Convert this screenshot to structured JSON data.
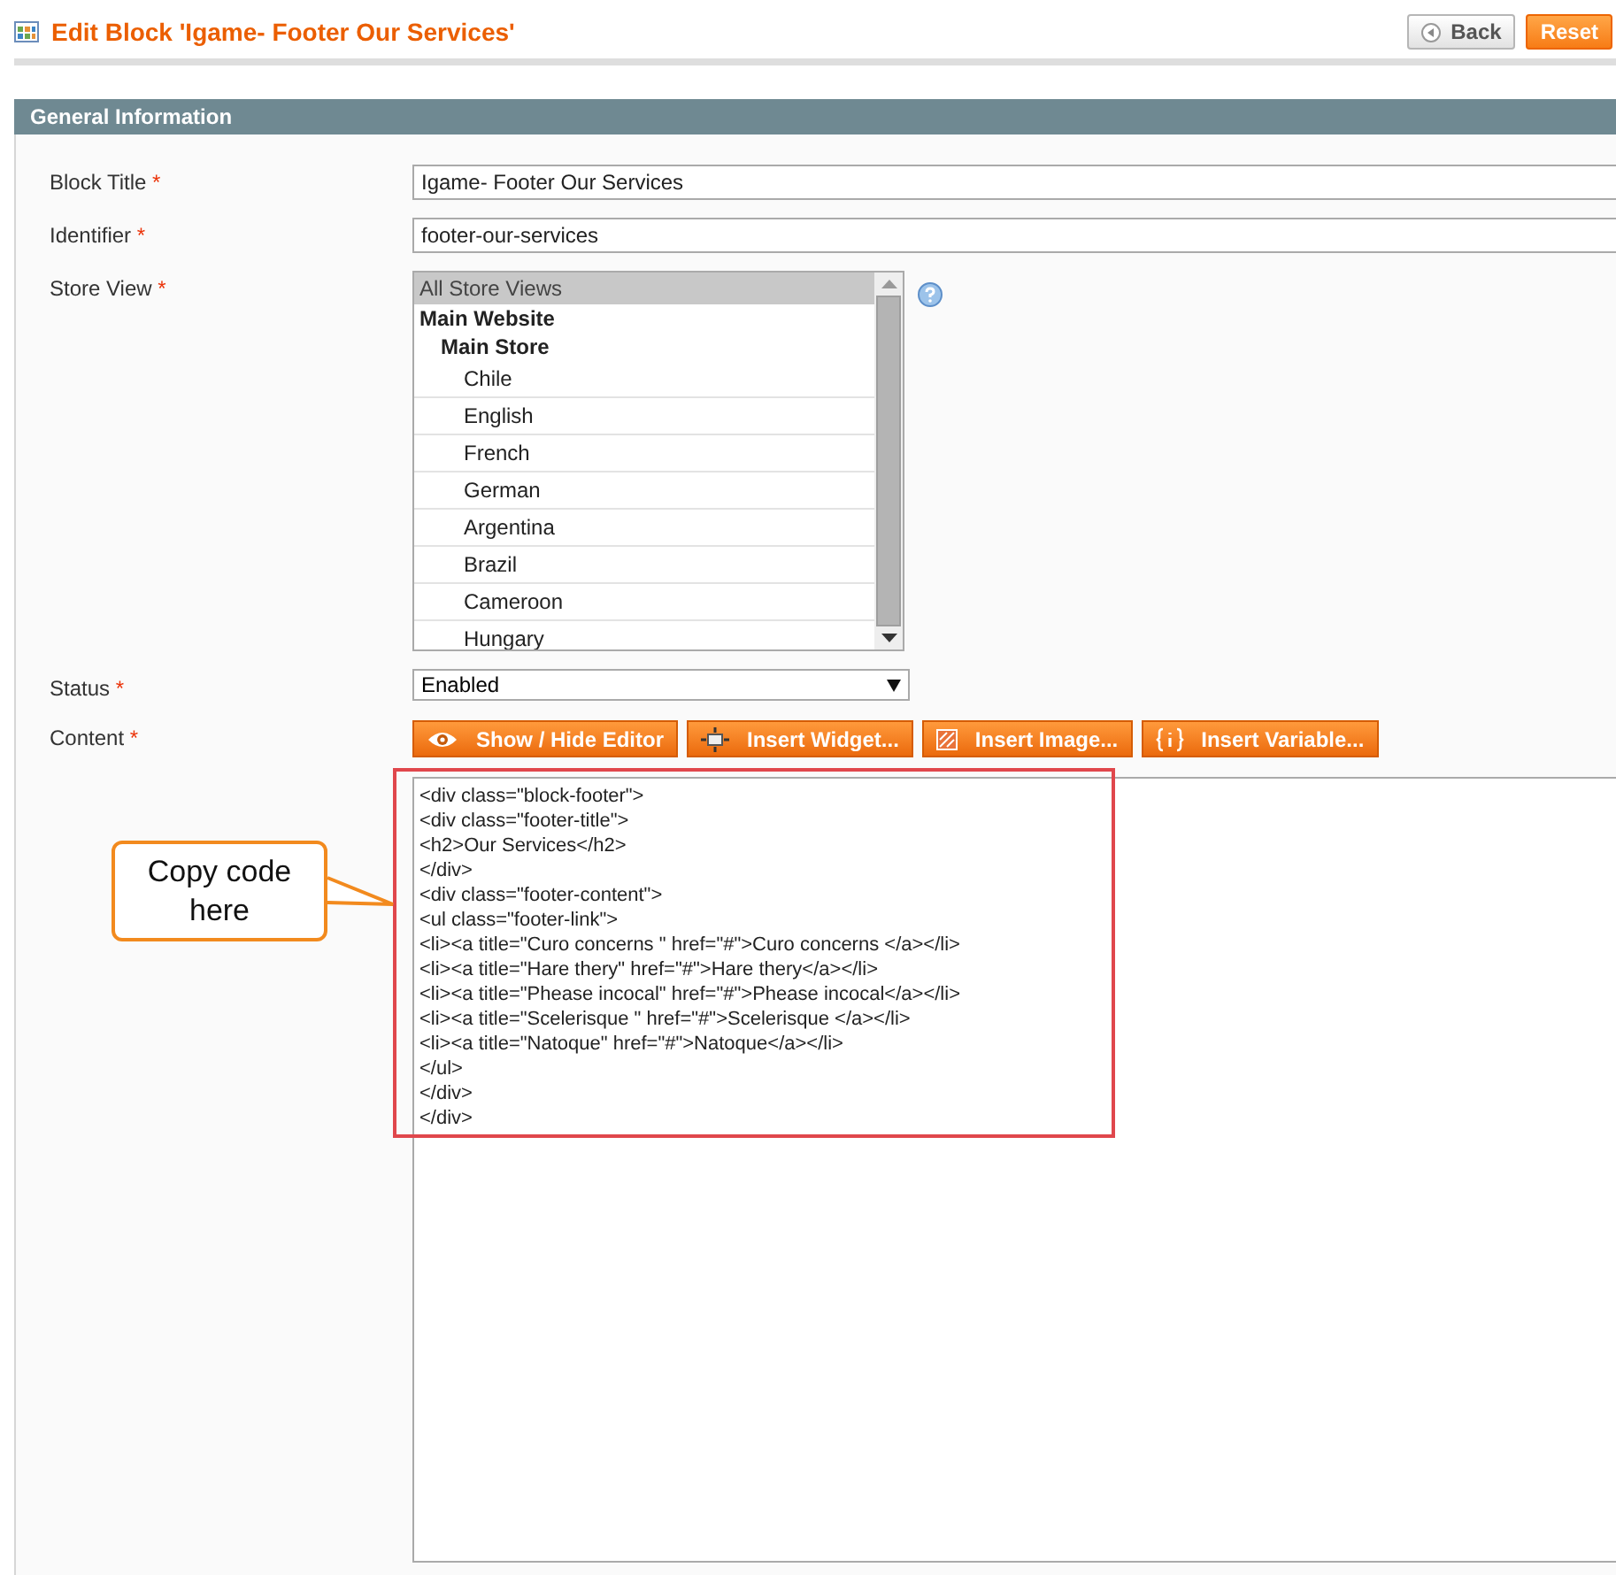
{
  "header": {
    "title": "Edit Block 'Igame- Footer Our Services'",
    "buttons": [
      {
        "label": "Back",
        "kind": "back"
      },
      {
        "label": "Reset",
        "kind": "primary"
      }
    ]
  },
  "section": {
    "title": "General Information"
  },
  "fields": [
    {
      "kind": "text",
      "label": "Block Title",
      "required_mark": "*",
      "value": "Igame- Footer Our Services"
    },
    {
      "kind": "text",
      "label": "Identifier",
      "required_mark": "*",
      "value": "footer-our-services"
    },
    {
      "kind": "listbox",
      "label": "Store View",
      "required_mark": "*",
      "options": [
        {
          "label": "All Store Views",
          "kind": "all",
          "selected": true
        },
        {
          "label": "Main Website",
          "kind": "website",
          "selected": false
        },
        {
          "label": "Main Store",
          "kind": "store",
          "selected": false
        },
        {
          "label": "Chile",
          "kind": "view",
          "selected": false
        },
        {
          "label": "English",
          "kind": "view",
          "selected": false
        },
        {
          "label": "French",
          "kind": "view",
          "selected": false
        },
        {
          "label": "German",
          "kind": "view",
          "selected": false
        },
        {
          "label": "Argentina",
          "kind": "view",
          "selected": false
        },
        {
          "label": "Brazil",
          "kind": "view",
          "selected": false
        },
        {
          "label": "Cameroon",
          "kind": "view",
          "selected": false
        },
        {
          "label": "Hungary",
          "kind": "view",
          "selected": false
        }
      ]
    },
    {
      "kind": "select",
      "label": "Status",
      "required_mark": "*",
      "value": "Enabled"
    },
    {
      "kind": "editor",
      "label": "Content",
      "required_mark": "*",
      "buttons": [
        {
          "label": "Show / Hide Editor",
          "kind": "eye"
        },
        {
          "label": "Insert Widget...",
          "kind": "widget"
        },
        {
          "label": "Insert Image...",
          "kind": "image"
        },
        {
          "label": "Insert Variable...",
          "kind": "variable"
        }
      ],
      "lines": [
        "<div class=\"block-footer\">",
        "<div class=\"footer-title\">",
        "<h2>Our Services</h2>",
        "</div>",
        "<div class=\"footer-content\">",
        "<ul class=\"footer-link\">",
        "<li><a title=\"Curo concerns \" href=\"#\">Curo concerns </a></li>",
        "<li><a title=\"Hare thery\" href=\"#\">Hare thery</a></li>",
        "<li><a title=\"Phease incocal\" href=\"#\">Phease incocal</a></li>",
        "<li><a title=\"Scelerisque \" href=\"#\">Scelerisque </a></li>",
        "<li><a title=\"Natoque\" href=\"#\">Natoque</a></li>",
        "</ul>",
        "</div>",
        "</div>"
      ]
    }
  ],
  "annotation": {
    "callout": "Copy code here"
  }
}
